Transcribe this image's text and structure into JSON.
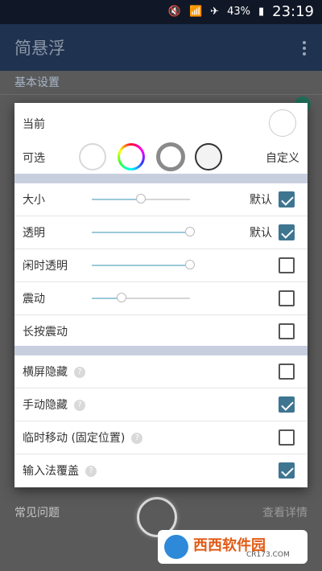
{
  "status": {
    "battery": "43%",
    "time": "23:19"
  },
  "app": {
    "title": "简悬浮"
  },
  "background": {
    "section": "基本设置",
    "faq": "常见问题",
    "details": "查看详情",
    "watermark_text": "西西软件园",
    "watermark_sub": "CR173.COM"
  },
  "dialog": {
    "current_label": "当前",
    "optional_label": "可选",
    "custom_label": "自定义",
    "size": {
      "label": "大小",
      "default": "默认",
      "value": 0.5,
      "checked": true
    },
    "transparency": {
      "label": "透明",
      "default": "默认",
      "value": 1.0,
      "checked": true
    },
    "idle_transparency": {
      "label": "闲时透明",
      "value": 1.0,
      "checked": false
    },
    "vibrate": {
      "label": "震动",
      "value": 0.3,
      "checked": false
    },
    "long_press_vibrate": {
      "label": "长按震动",
      "checked": false
    },
    "landscape_hide": {
      "label": "横屏隐藏",
      "help": "?",
      "checked": false
    },
    "manual_hide": {
      "label": "手动隐藏",
      "help": "?",
      "checked": true
    },
    "temp_move": {
      "label": "临时移动 (固定位置)",
      "help": "?",
      "checked": false
    },
    "ime_cover": {
      "label": "输入法覆盖",
      "help": "?",
      "checked": true
    }
  }
}
